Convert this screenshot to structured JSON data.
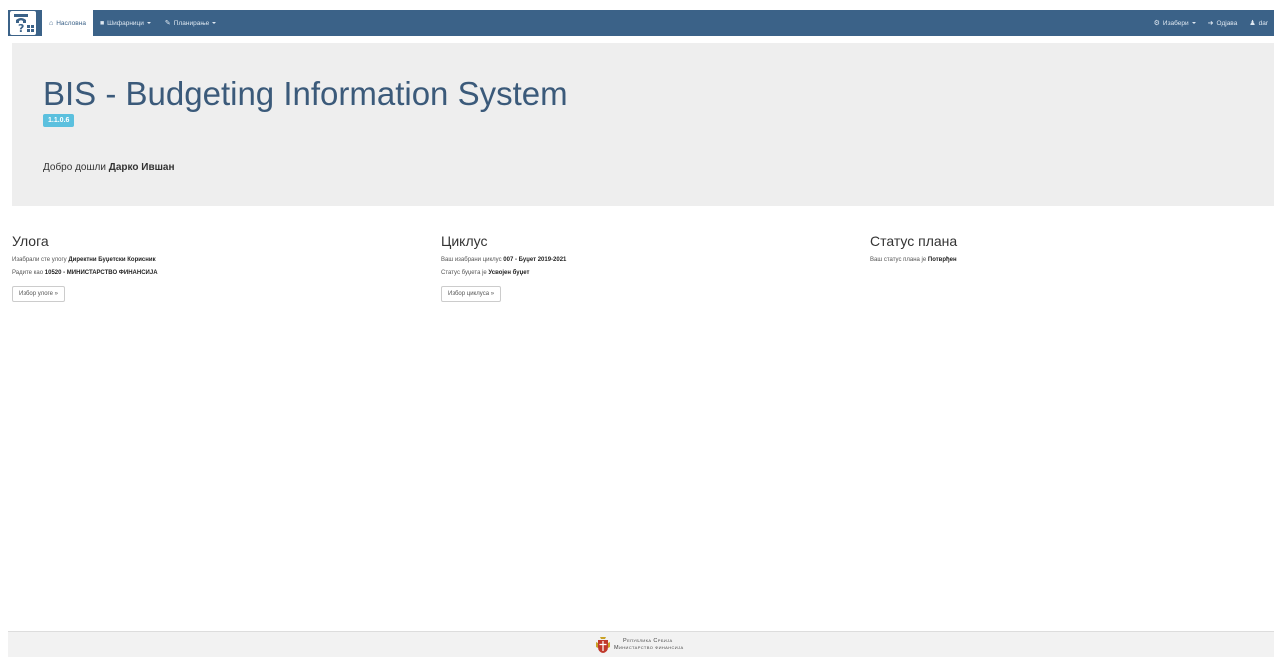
{
  "navbar": {
    "logo": "budget-logo-icon",
    "items": [
      {
        "label": "Насловна",
        "icon": "home-icon",
        "active": true
      },
      {
        "label": "Шифарници",
        "icon": "book-icon",
        "dropdown": true
      },
      {
        "label": "Планирање",
        "icon": "wrench-icon",
        "dropdown": true
      }
    ],
    "right": {
      "select_label": "Изабери",
      "logout_label": "Одјава",
      "user_label": "dar"
    },
    "color": "#3b6288"
  },
  "jumbotron": {
    "title": "BIS - Budgeting Information System",
    "version": "1.1.0.6",
    "welcome_prefix": "Добро дошли",
    "user_name": "Дарко Ившан"
  },
  "role": {
    "heading": "Улога",
    "line1_prefix": "Изабрали сте улогу",
    "line1_value": "Директни Буџетски Корисник",
    "line2_prefix": "Радите као",
    "line2_value": "10520 - МИНИСТАРСТВО ФИНАНСИЈА",
    "button": "Избор улоге »"
  },
  "cycle": {
    "heading": "Циклус",
    "line1_prefix": "Ваш изабрани циклус",
    "line1_value": "007 - Буџет 2019-2021",
    "line2_prefix": "Статус буџета је",
    "line2_value": "Усвојен буџет",
    "button": "Избор циклуса »"
  },
  "plan_status": {
    "heading": "Статус плана",
    "line1_prefix": "Ваш статус плана је",
    "line1_value": "Потврђен"
  },
  "footer": {
    "line1": "Република Србија",
    "line2": "Министарство финансија",
    "emblem": "coat-of-arms-icon"
  },
  "colors": {
    "accent": "#3b6288",
    "badge": "#5bc0de",
    "jumbotron_bg": "#eeeeee"
  }
}
